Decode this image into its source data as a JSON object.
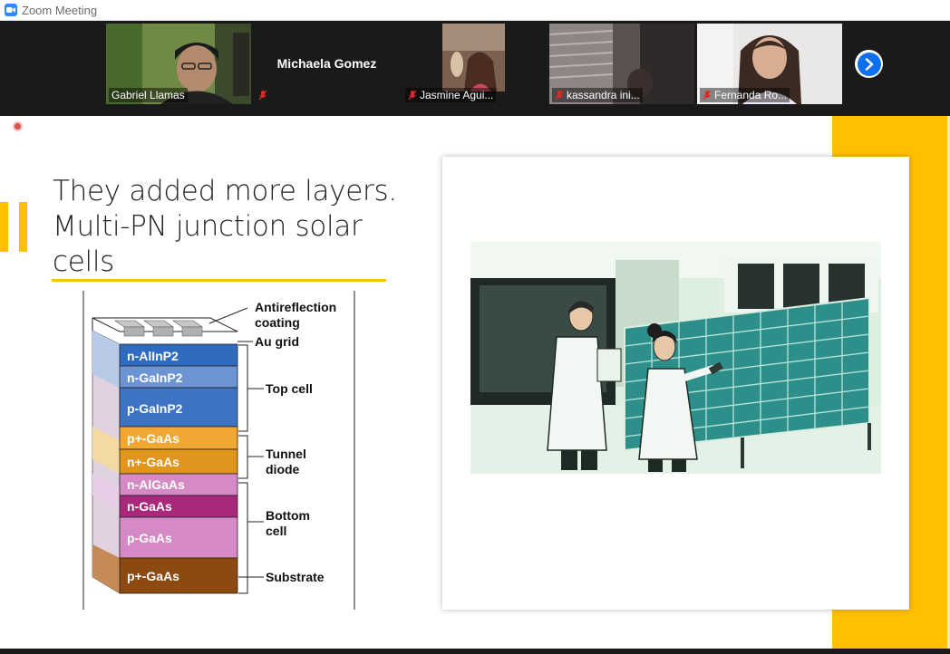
{
  "window": {
    "title": "Zoom Meeting"
  },
  "gallery": {
    "participants": [
      {
        "name": "Gabriel Llamas",
        "muted": false
      },
      {
        "name": "Michaela Gomez",
        "muted": true
      },
      {
        "name": "Jasmine Agui...",
        "muted": true
      },
      {
        "name": "kassandra ini...",
        "muted": true
      },
      {
        "name": "Fernanda Ro...",
        "muted": true
      }
    ],
    "next_icon": "chevron-right-icon"
  },
  "slide": {
    "title_lines": [
      "They added more layers.",
      "Multi-PN junction solar",
      "cells"
    ],
    "accent_color": "#ffc000",
    "diagram": {
      "layers": [
        "n-AlInP2",
        "n-GaInP2",
        "p-GaInP2",
        "p+-GaAs",
        "n+-GaAs",
        "n-AlGaAs",
        "n-GaAs",
        "p-GaAs",
        "p+-GaAs"
      ],
      "callouts": [
        "Antireflection",
        "coating",
        "Au grid",
        "Top cell",
        "Tunnel",
        "diode",
        "Bottom",
        "cell",
        "Substrate"
      ]
    }
  }
}
